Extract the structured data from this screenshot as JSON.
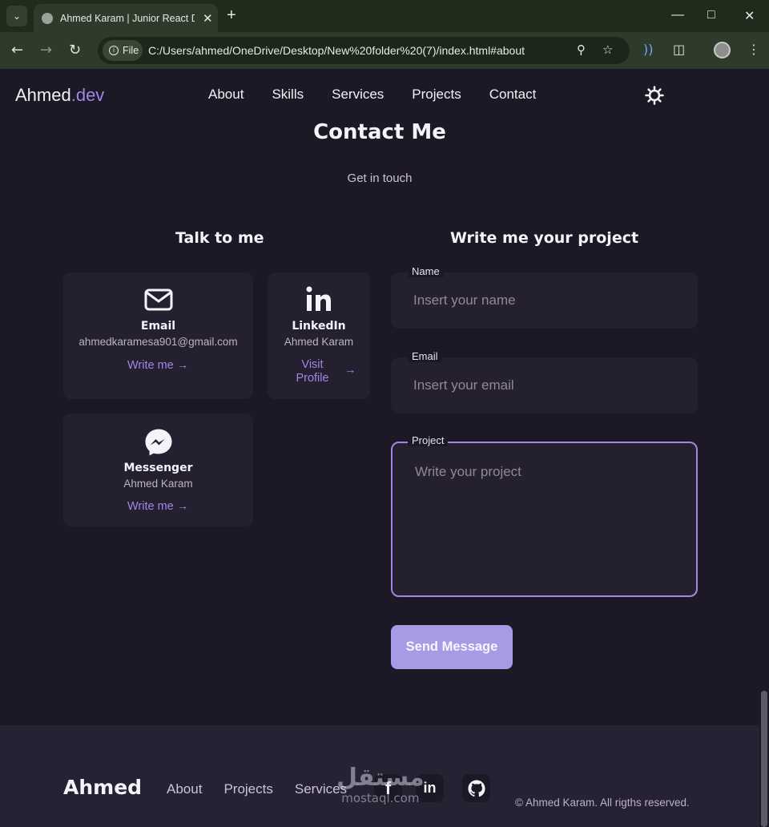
{
  "browser": {
    "tab_title": "Ahmed Karam | Junior React De",
    "url_chip": "File",
    "url": "C:/Users/ahmed/OneDrive/Desktop/New%20folder%20(7)/index.html#about",
    "new_tab": "+",
    "tab_close": "✕",
    "tab_menu": "⌄"
  },
  "header": {
    "logo_main": "Ahmed",
    "logo_accent": ".dev",
    "nav": [
      "About",
      "Skills",
      "Services",
      "Projects",
      "Contact"
    ]
  },
  "contact": {
    "title": "Contact Me",
    "subtitle": "Get in touch",
    "talk_title": "Talk to me",
    "write_title": "Write me your project",
    "cards": [
      {
        "icon": "mail-icon",
        "title": "Email",
        "data": "ahmedkaramesa901@gmail.com",
        "link": "Write me"
      },
      {
        "icon": "linkedin-icon",
        "title": "LinkedIn",
        "data": "Ahmed Karam",
        "link": "Visit Profile"
      },
      {
        "icon": "messenger-icon",
        "title": "Messenger",
        "data": "Ahmed Karam",
        "link": "Write me"
      }
    ],
    "form": {
      "name_label": "Name",
      "name_placeholder": "Insert your name",
      "email_label": "Email",
      "email_placeholder": "Insert your email",
      "project_label": "Project",
      "project_placeholder": "Write your project",
      "send_label": "Send Message"
    }
  },
  "footer": {
    "logo": "Ahmed",
    "links": [
      "About",
      "Projects",
      "Services"
    ],
    "social": [
      "facebook-icon",
      "linkedin-icon",
      "github-icon"
    ],
    "copyright": "© Ahmed Karam. All rigths reserved.",
    "watermark_ar": "مستقل",
    "watermark_lat": "mostaql.com"
  },
  "colors": {
    "accent": "#9d88e8",
    "background": "#1c1826",
    "card": "#25202f",
    "button": "#a79be6"
  }
}
